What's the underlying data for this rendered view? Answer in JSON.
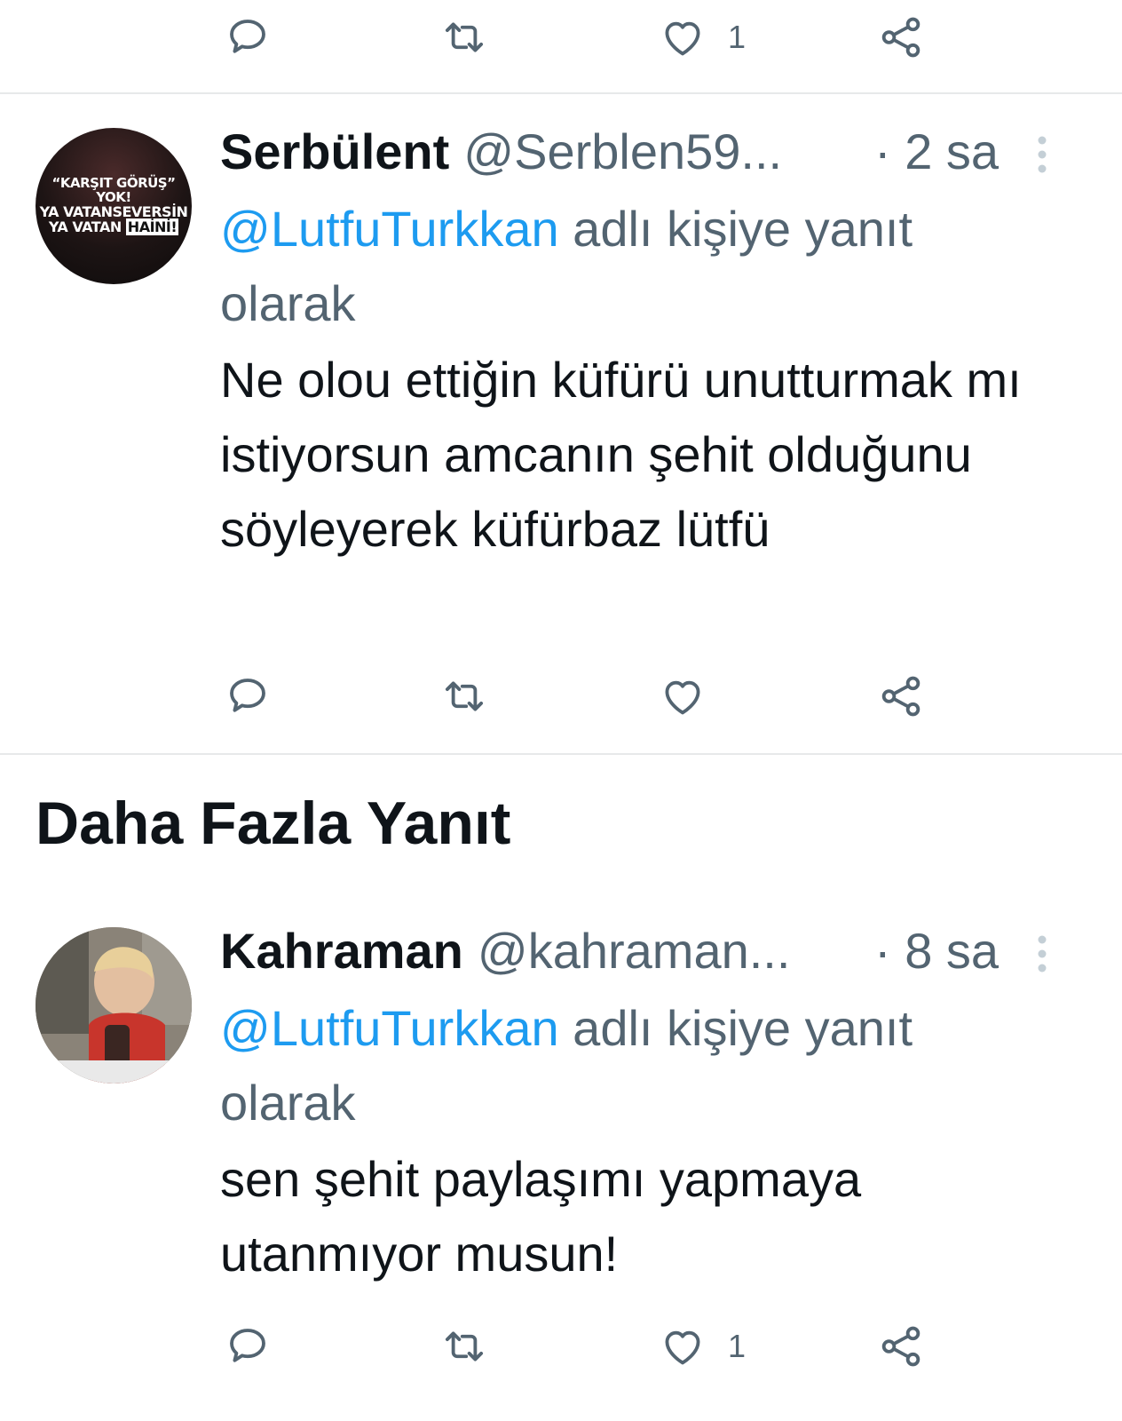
{
  "top_actions": {
    "like_count": "1"
  },
  "tweets": [
    {
      "name": "Serbülent",
      "handle": "@Serblen59...",
      "time": "· 2 sa",
      "avatar_text": {
        "line1": "“KARŞIT GÖRÜŞ” YOK!",
        "line2": "YA VATANSEVERSİN",
        "line3_prefix": "YA VATAN ",
        "line3_highlight": "HAİNİ!"
      },
      "reply_mention": "@LutfuTurkkan",
      "reply_suffix": " adlı kişiye yanıt olarak",
      "text": "Ne olou ettiğin küfürü unutturmak mı istiyorsun amcanın şehit olduğunu söyleyerek küfürbaz lütfü",
      "like_count": ""
    },
    {
      "name": "Kahraman",
      "handle": "@kahraman...",
      "time": "· 8 sa",
      "reply_mention": "@LutfuTurkkan",
      "reply_suffix": " adlı kişiye yanıt olarak",
      "text": "sen şehit paylaşımı yapmaya utanmıyor musun!",
      "like_count": "1"
    }
  ],
  "section": {
    "title": "Daha Fazla Yanıt"
  },
  "icons": {
    "reply": "reply-icon",
    "retweet": "retweet-icon",
    "like": "heart-icon",
    "share": "share-icon",
    "more": "more-vertical-icon"
  },
  "colors": {
    "text": "#0f1419",
    "secondary": "#536471",
    "mention": "#1d9bf0",
    "divider": "#e7e9ea"
  }
}
